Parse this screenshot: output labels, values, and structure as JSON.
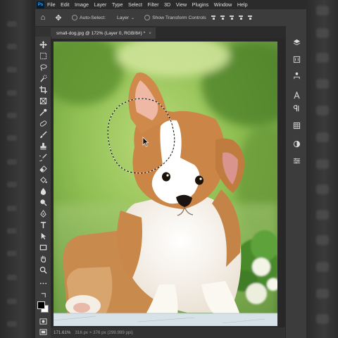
{
  "app": {
    "name": "Photoshop",
    "logo": "Ps"
  },
  "menu": [
    "File",
    "Edit",
    "Image",
    "Layer",
    "Type",
    "Select",
    "Filter",
    "3D",
    "View",
    "Plugins",
    "Window",
    "Help"
  ],
  "options": {
    "auto_select_label": "Auto-Select:",
    "layer_value": "Layer",
    "show_transform_label": "Show Transform Controls"
  },
  "document": {
    "tab_title": "small-dog.jpg @ 172% (Layer 0, RGB/8#) *",
    "close_glyph": "×"
  },
  "status": {
    "zoom": "171.61%",
    "doc_info": "316 px × 376 px (299.999 ppi)"
  },
  "tools": [
    "move-tool",
    "marquee-tool",
    "lasso-tool",
    "quick-selection-tool",
    "crop-tool",
    "frame-tool",
    "eyedropper-tool",
    "spot-healing-tool",
    "brush-tool",
    "clone-stamp-tool",
    "history-brush-tool",
    "eraser-tool",
    "paint-bucket-tool",
    "blur-tool",
    "dodge-tool",
    "pen-tool",
    "type-tool",
    "path-selection-tool",
    "rectangle-tool",
    "hand-tool",
    "zoom-tool",
    "more-tools"
  ],
  "colors": {
    "foreground": "#000000",
    "background": "#ffffff",
    "selection": "#ffffff"
  }
}
